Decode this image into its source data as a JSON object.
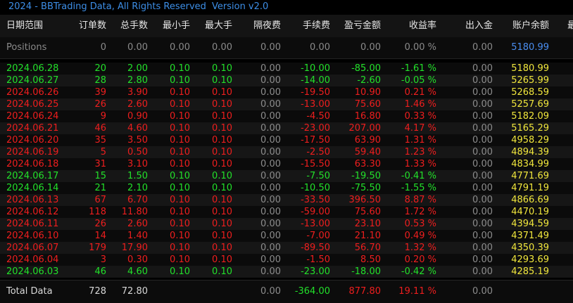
{
  "title": {
    "copyright": "2024 - BBTrading Data, All Rights Reserved",
    "version": "Version v2.0"
  },
  "columns": [
    "日期范围",
    "订单数",
    "总手数",
    "最小手",
    "最大手",
    "隔夜费",
    "手续费",
    "盈亏金额",
    "收益率",
    "出入金",
    "账户余额",
    "最"
  ],
  "summary": {
    "label": "Positions",
    "orders": "0",
    "lots": "0.00",
    "min_lot": "0.00",
    "max_lot": "0.00",
    "swap": "0.00",
    "commission": "0.00",
    "profit": "0.00",
    "return": "0.00 %",
    "deposit": "0.00",
    "balance": "5180.99"
  },
  "rows": [
    {
      "date": "2024.06.28",
      "orders": "20",
      "lots": "2.00",
      "min_lot": "0.10",
      "max_lot": "0.10",
      "swap": "0.00",
      "commission": "-10.00",
      "profit": "-85.00",
      "return": "-1.61 %",
      "deposit": "0.00",
      "balance": "5180.99",
      "trend": "up"
    },
    {
      "date": "2024.06.27",
      "orders": "28",
      "lots": "2.80",
      "min_lot": "0.10",
      "max_lot": "0.10",
      "swap": "0.00",
      "commission": "-14.00",
      "profit": "-2.60",
      "return": "-0.05 %",
      "deposit": "0.00",
      "balance": "5265.99",
      "trend": "up"
    },
    {
      "date": "2024.06.26",
      "orders": "39",
      "lots": "3.90",
      "min_lot": "0.10",
      "max_lot": "0.10",
      "swap": "0.00",
      "commission": "-19.50",
      "profit": "10.90",
      "return": "0.21 %",
      "deposit": "0.00",
      "balance": "5268.59",
      "trend": "down"
    },
    {
      "date": "2024.06.25",
      "orders": "26",
      "lots": "2.60",
      "min_lot": "0.10",
      "max_lot": "0.10",
      "swap": "0.00",
      "commission": "-13.00",
      "profit": "75.60",
      "return": "1.46 %",
      "deposit": "0.00",
      "balance": "5257.69",
      "trend": "down"
    },
    {
      "date": "2024.06.24",
      "orders": "9",
      "lots": "0.90",
      "min_lot": "0.10",
      "max_lot": "0.10",
      "swap": "0.00",
      "commission": "-4.50",
      "profit": "16.80",
      "return": "0.33 %",
      "deposit": "0.00",
      "balance": "5182.09",
      "trend": "down"
    },
    {
      "date": "2024.06.21",
      "orders": "46",
      "lots": "4.60",
      "min_lot": "0.10",
      "max_lot": "0.10",
      "swap": "0.00",
      "commission": "-23.00",
      "profit": "207.00",
      "return": "4.17 %",
      "deposit": "0.00",
      "balance": "5165.29",
      "trend": "down"
    },
    {
      "date": "2024.06.20",
      "orders": "35",
      "lots": "3.50",
      "min_lot": "0.10",
      "max_lot": "0.10",
      "swap": "0.00",
      "commission": "-17.50",
      "profit": "63.90",
      "return": "1.31 %",
      "deposit": "0.00",
      "balance": "4958.29",
      "trend": "down"
    },
    {
      "date": "2024.06.19",
      "orders": "5",
      "lots": "0.50",
      "min_lot": "0.10",
      "max_lot": "0.10",
      "swap": "0.00",
      "commission": "-2.50",
      "profit": "59.40",
      "return": "1.23 %",
      "deposit": "0.00",
      "balance": "4894.39",
      "trend": "down"
    },
    {
      "date": "2024.06.18",
      "orders": "31",
      "lots": "3.10",
      "min_lot": "0.10",
      "max_lot": "0.10",
      "swap": "0.00",
      "commission": "-15.50",
      "profit": "63.30",
      "return": "1.33 %",
      "deposit": "0.00",
      "balance": "4834.99",
      "trend": "down"
    },
    {
      "date": "2024.06.17",
      "orders": "15",
      "lots": "1.50",
      "min_lot": "0.10",
      "max_lot": "0.10",
      "swap": "0.00",
      "commission": "-7.50",
      "profit": "-19.50",
      "return": "-0.41 %",
      "deposit": "0.00",
      "balance": "4771.69",
      "trend": "up"
    },
    {
      "date": "2024.06.14",
      "orders": "21",
      "lots": "2.10",
      "min_lot": "0.10",
      "max_lot": "0.10",
      "swap": "0.00",
      "commission": "-10.50",
      "profit": "-75.50",
      "return": "-1.55 %",
      "deposit": "0.00",
      "balance": "4791.19",
      "trend": "up"
    },
    {
      "date": "2024.06.13",
      "orders": "67",
      "lots": "6.70",
      "min_lot": "0.10",
      "max_lot": "0.10",
      "swap": "0.00",
      "commission": "-33.50",
      "profit": "396.50",
      "return": "8.87 %",
      "deposit": "0.00",
      "balance": "4866.69",
      "trend": "down"
    },
    {
      "date": "2024.06.12",
      "orders": "118",
      "lots": "11.80",
      "min_lot": "0.10",
      "max_lot": "0.10",
      "swap": "0.00",
      "commission": "-59.00",
      "profit": "75.60",
      "return": "1.72 %",
      "deposit": "0.00",
      "balance": "4470.19",
      "trend": "down"
    },
    {
      "date": "2024.06.11",
      "orders": "26",
      "lots": "2.60",
      "min_lot": "0.10",
      "max_lot": "0.10",
      "swap": "0.00",
      "commission": "-13.00",
      "profit": "23.10",
      "return": "0.53 %",
      "deposit": "0.00",
      "balance": "4394.59",
      "trend": "down"
    },
    {
      "date": "2024.06.10",
      "orders": "14",
      "lots": "1.40",
      "min_lot": "0.10",
      "max_lot": "0.10",
      "swap": "0.00",
      "commission": "-7.00",
      "profit": "21.10",
      "return": "0.49 %",
      "deposit": "0.00",
      "balance": "4371.49",
      "trend": "down"
    },
    {
      "date": "2024.06.07",
      "orders": "179",
      "lots": "17.90",
      "min_lot": "0.10",
      "max_lot": "0.10",
      "swap": "0.00",
      "commission": "-89.50",
      "profit": "56.70",
      "return": "1.32 %",
      "deposit": "0.00",
      "balance": "4350.39",
      "trend": "down"
    },
    {
      "date": "2024.06.04",
      "orders": "3",
      "lots": "0.30",
      "min_lot": "0.10",
      "max_lot": "0.10",
      "swap": "0.00",
      "commission": "-1.50",
      "profit": "8.50",
      "return": "0.20 %",
      "deposit": "0.00",
      "balance": "4293.69",
      "trend": "down"
    },
    {
      "date": "2024.06.03",
      "orders": "46",
      "lots": "4.60",
      "min_lot": "0.10",
      "max_lot": "0.10",
      "swap": "0.00",
      "commission": "-23.00",
      "profit": "-18.00",
      "return": "-0.42 %",
      "deposit": "0.00",
      "balance": "4285.19",
      "trend": "up"
    }
  ],
  "total": {
    "label": "Total Data",
    "orders": "728",
    "lots": "72.80",
    "swap": "0.00",
    "commission": "-364.00",
    "profit": "877.80",
    "return": "19.11 %",
    "deposit": "0.00"
  },
  "colors": {
    "gain": "#22e02a",
    "loss": "#ee1e1e",
    "balance": "#f0e63c",
    "accent": "#3d8ee6"
  }
}
